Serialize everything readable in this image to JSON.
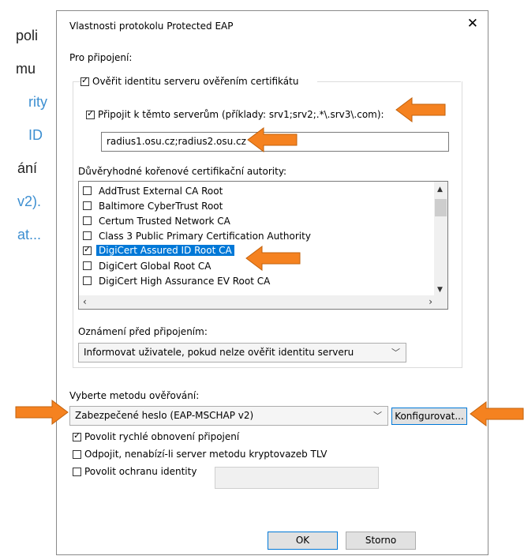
{
  "background_text": {
    "line1": "poli",
    "line2": "mu",
    "line3": "rity",
    "line4": "ID",
    "line5": "ání",
    "line6": "v2).",
    "line7": "at..."
  },
  "dialog": {
    "title": "Vlastnosti protokolu Protected EAP",
    "close_glyph": "✕",
    "connection_label": "Pro připojení:",
    "verify_cert_label": "Ověřit identitu serveru ověřením certifikátu",
    "connect_servers_label": "Připojit k těmto serverům (příklady: srv1;srv2;.*\\.srv3\\.com):",
    "servers_value": "radius1.osu.cz;radius2.osu.cz",
    "trusted_ca_label": "Důvěryhodné kořenové certifikační autority:",
    "ca_list": [
      {
        "label": "AddTrust External CA Root",
        "checked": false,
        "selected": false
      },
      {
        "label": "Baltimore CyberTrust Root",
        "checked": false,
        "selected": false
      },
      {
        "label": "Certum Trusted Network CA",
        "checked": false,
        "selected": false
      },
      {
        "label": "Class 3 Public Primary Certification Authority",
        "checked": false,
        "selected": false
      },
      {
        "label": "DigiCert Assured ID Root CA",
        "checked": true,
        "selected": true
      },
      {
        "label": "DigiCert Global Root CA",
        "checked": false,
        "selected": false
      },
      {
        "label": "DigiCert High Assurance EV Root CA",
        "checked": false,
        "selected": false
      }
    ],
    "notify_label": "Oznámení před připojením:",
    "notify_value": "Informovat uživatele, pokud nelze ověřit identitu serveru",
    "auth_method_label": "Vyberte metodu ověřování:",
    "auth_method_value": "Zabezpečené heslo (EAP-MSCHAP v2)",
    "configure_button": "Konfigurovat...",
    "fast_reconnect_label": "Povolit rychlé obnovení připojení",
    "disconnect_label": "Odpojit, nenabízí-li server metodu kryptovazeb TLV",
    "identity_privacy_label": "Povolit ochranu identity",
    "identity_value": "",
    "ok_button": "OK",
    "cancel_button": "Storno"
  },
  "colors": {
    "accent": "#0078d7",
    "highlight_arrow": "#f58220",
    "link_blue": "#3d8fd1"
  }
}
